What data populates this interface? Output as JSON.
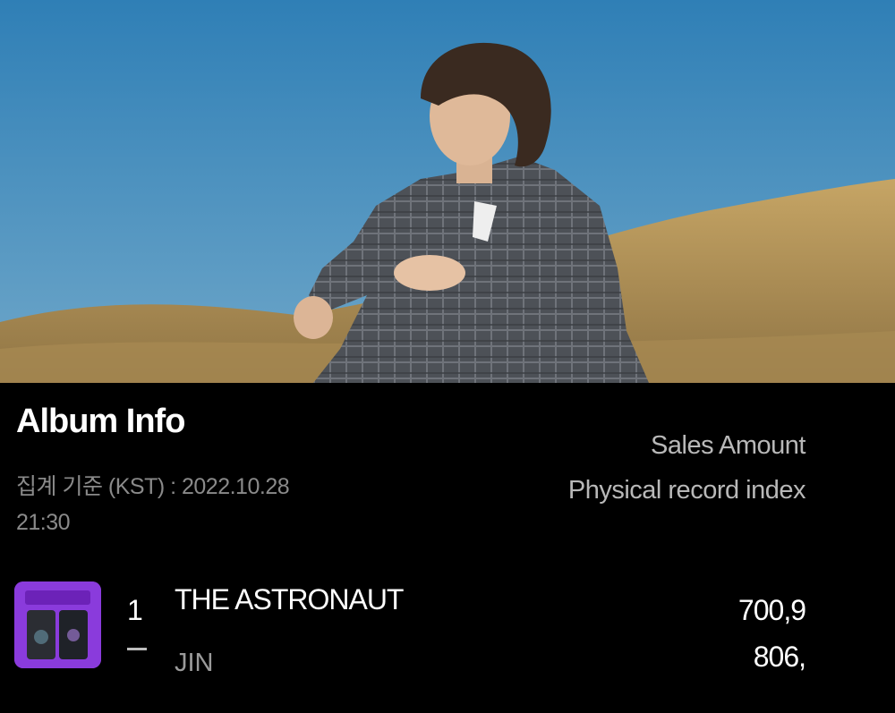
{
  "hero": {
    "alt": "artist photo sitting on a grassy hill under blue sky"
  },
  "album_info": {
    "title": "Album Info",
    "basis_label": "집계 기준 (KST) : 2022.10.28 21:30",
    "metric_labels": [
      "Sales Amount",
      "Physical record index"
    ]
  },
  "entries": [
    {
      "rank": "1",
      "rank_change": "—",
      "album_title": "THE ASTRONAUT",
      "artist": "JIN",
      "sales_amount": "700,9",
      "physical_index": "806,"
    }
  ],
  "colors": {
    "background": "#000000",
    "cover_accent": "#8a3bdc",
    "sky": "#3f86b6",
    "grass": "#b89a5c"
  }
}
